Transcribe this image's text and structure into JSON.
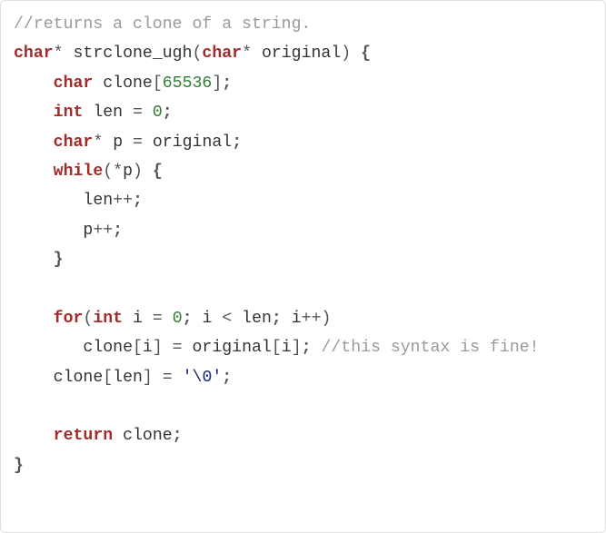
{
  "code": {
    "tokens": {
      "c1": "//returns a clone of a string.",
      "kw_char1": "char",
      "star1": "*",
      "sp": " ",
      "fn_name": "strclone_ugh",
      "lp1": "(",
      "kw_char2": "char",
      "star2": "*",
      "arg": "original",
      "rp1": ")",
      "lb1": "{",
      "ind1": "    ",
      "kw_char3": "char",
      "var_clone": "clone",
      "lbrk": "[",
      "num_65536": "65536",
      "rbrk": "]",
      "semi": ";",
      "kw_int": "int",
      "var_len": "len",
      "eq": "=",
      "num_0a": "0",
      "kw_char4": "char",
      "star3": "*",
      "var_p": "p",
      "var_original": "original",
      "kw_while": "while",
      "lp2": "(",
      "deref": "*",
      "rp2": ")",
      "lb2": "{",
      "ind2": "       ",
      "incr": "++",
      "rb2": "}",
      "kw_for": "for",
      "lp3": "(",
      "kw_int2": "int",
      "var_i": "i",
      "num_0b": "0",
      "lt": "<",
      "rp3": ")",
      "ind3": "       ",
      "var_clone2": "clone",
      "var_i2": "i",
      "var_original2": "original",
      "c2": "//this syntax is fine!",
      "var_clone3": "clone",
      "var_len3": "len",
      "char_nul": "'\\0'",
      "kw_return": "return",
      "var_clone4": "clone",
      "rb1": "}"
    }
  }
}
